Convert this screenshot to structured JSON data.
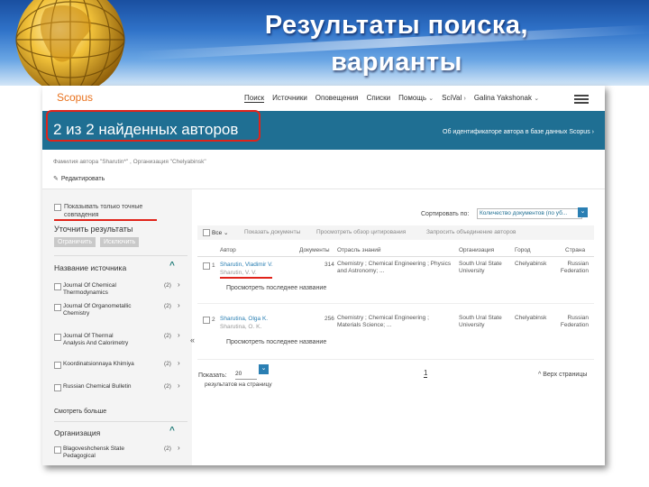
{
  "slide": {
    "title_line1": "Результаты поиска,",
    "title_line2": "варианты"
  },
  "app": {
    "logo": "Scopus",
    "nav": [
      {
        "label": "Поиск",
        "active": true
      },
      {
        "label": "Источники"
      },
      {
        "label": "Оповещения"
      },
      {
        "label": "Списки"
      },
      {
        "label": "Помощь",
        "dropdown": true
      },
      {
        "label": "SciVal",
        "dropdown": true
      },
      {
        "label": "Galina Yakshonak",
        "dropdown": true
      }
    ],
    "menu_icon": "hamburger-icon"
  },
  "banner": {
    "title": "2 из 2 найденных авторов",
    "link": "Об идентификаторе автора в базе данных Scopus",
    "color": "#1f6f93"
  },
  "query": {
    "text": "Фамилия автора \"Sharutin*\" , Организация \"Chelyabinsk\"",
    "edit_label": "Редактировать"
  },
  "sidebar": {
    "exact_match_label": "Показывать только точные совпадения",
    "refine_title": "Уточнить результаты",
    "limit_button": "Ограничить",
    "exclude_button": "Исключить",
    "source_section_title": "Название источника",
    "sources": [
      {
        "name": "Journal Of Chemical Thermodynamics",
        "count": "(2)"
      },
      {
        "name": "Journal Of Organometallic Chemistry",
        "count": "(2)"
      },
      {
        "name": "Journal Of Thermal Analysis And Calorimetry",
        "count": "(2)"
      },
      {
        "name": "Koordinatsionnaya Khimiya",
        "count": "(2)"
      },
      {
        "name": "Russian Chemical Bulletin",
        "count": "(2)"
      }
    ],
    "show_more": "Смотреть больше",
    "org_section_title": "Организация",
    "orgs": [
      {
        "name": "Blagoveshchensk State Pedagogical",
        "count": "(2)"
      }
    ],
    "collapse_glyph": "«"
  },
  "results": {
    "sort_label": "Сортировать по:",
    "sort_value": "Количество документов (по уб...",
    "toolbar": {
      "all": "Все",
      "show_docs": "Показать документы",
      "view_citations": "Просмотреть обзор цитирования",
      "request_merge": "Запросить объединение авторов"
    },
    "columns": [
      "Автор",
      "Документы",
      "Отрасль знаний",
      "Организация",
      "Город",
      "Страна"
    ],
    "rows": [
      {
        "num": "1",
        "name": "Sharutin, Vladimir V.",
        "variant": "Sharutin, V. V.",
        "link": "Просмотреть последнее название",
        "docs": "314",
        "field": "Chemistry ; Chemical Engineering ; Physics and Astronomy; ...",
        "org": "South Ural State University",
        "city": "Chelyabinsk",
        "country": "Russian Federation"
      },
      {
        "num": "2",
        "name": "Sharutina, Olga K.",
        "variant": "Sharutina, O. K.",
        "link": "Просмотреть последнее название",
        "docs": "256",
        "field": "Chemistry ; Chemical Engineering ; Materials Science; ...",
        "org": "South Ural State University",
        "city": "Chelyabinsk",
        "country": "Russian Federation"
      }
    ],
    "show_label": "Показать:",
    "per_page": "20",
    "per_page_suffix": "результатов на страницу",
    "page": "1",
    "to_top": "Верх страницы"
  },
  "colors": {
    "accent": "#2a7fb3",
    "highlight": "#e0231a",
    "logo": "#e9711c"
  }
}
